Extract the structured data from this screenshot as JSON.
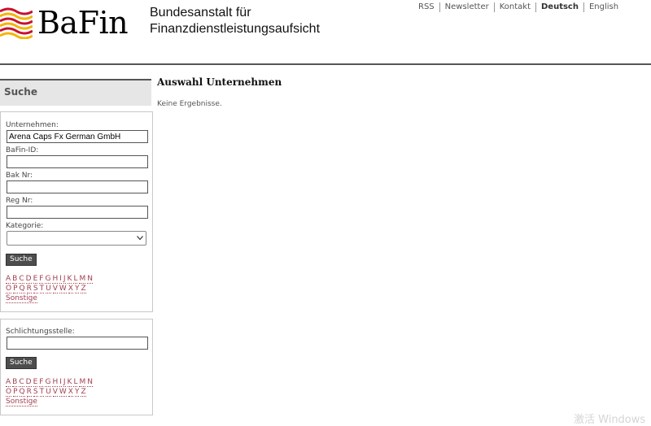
{
  "header": {
    "logo_text": "BaFin",
    "org_line1": "Bundesanstalt für",
    "org_line2": "Finanzdienstleistungsaufsicht",
    "nav": [
      "RSS",
      "Newsletter",
      "Kontakt",
      "Deutsch",
      "English"
    ],
    "active_nav": "Deutsch"
  },
  "sidebar": {
    "title": "Suche",
    "form1": {
      "company_label": "Unternehmen:",
      "company_value": "Arena Caps Fx German GmbH",
      "bafin_id_label": "BaFin-ID:",
      "bafin_id_value": "",
      "bak_label": "Bak Nr:",
      "bak_value": "",
      "reg_label": "Reg Nr:",
      "reg_value": "",
      "category_label": "Kategorie:",
      "category_value": "",
      "search_button": "Suche",
      "alpha_row1": [
        "A",
        "B",
        "C",
        "D",
        "E",
        "F",
        "G",
        "H",
        "I",
        "J",
        "K",
        "L",
        "M",
        "N"
      ],
      "alpha_row2": [
        "O",
        "P",
        "Q",
        "R",
        "S",
        "T",
        "U",
        "V",
        "W",
        "X",
        "Y",
        "Z"
      ],
      "other": "Sonstige"
    },
    "form2": {
      "label": "Schlichtungsstelle:",
      "value": "",
      "search_button": "Suche",
      "alpha_row1": [
        "A",
        "B",
        "C",
        "D",
        "E",
        "F",
        "G",
        "H",
        "I",
        "J",
        "K",
        "L",
        "M",
        "N"
      ],
      "alpha_row2": [
        "O",
        "P",
        "Q",
        "R",
        "S",
        "T",
        "U",
        "V",
        "W",
        "X",
        "Y",
        "Z"
      ],
      "other": "Sonstige"
    }
  },
  "main": {
    "title": "Auswahl Unternehmen",
    "message": "Keine Ergebnisse."
  },
  "watermark": "激活 Windows",
  "colors": {
    "accent_red": "#c8102e",
    "accent_yellow": "#f4b400",
    "link": "#a04050",
    "button": "#4d4d4d"
  }
}
